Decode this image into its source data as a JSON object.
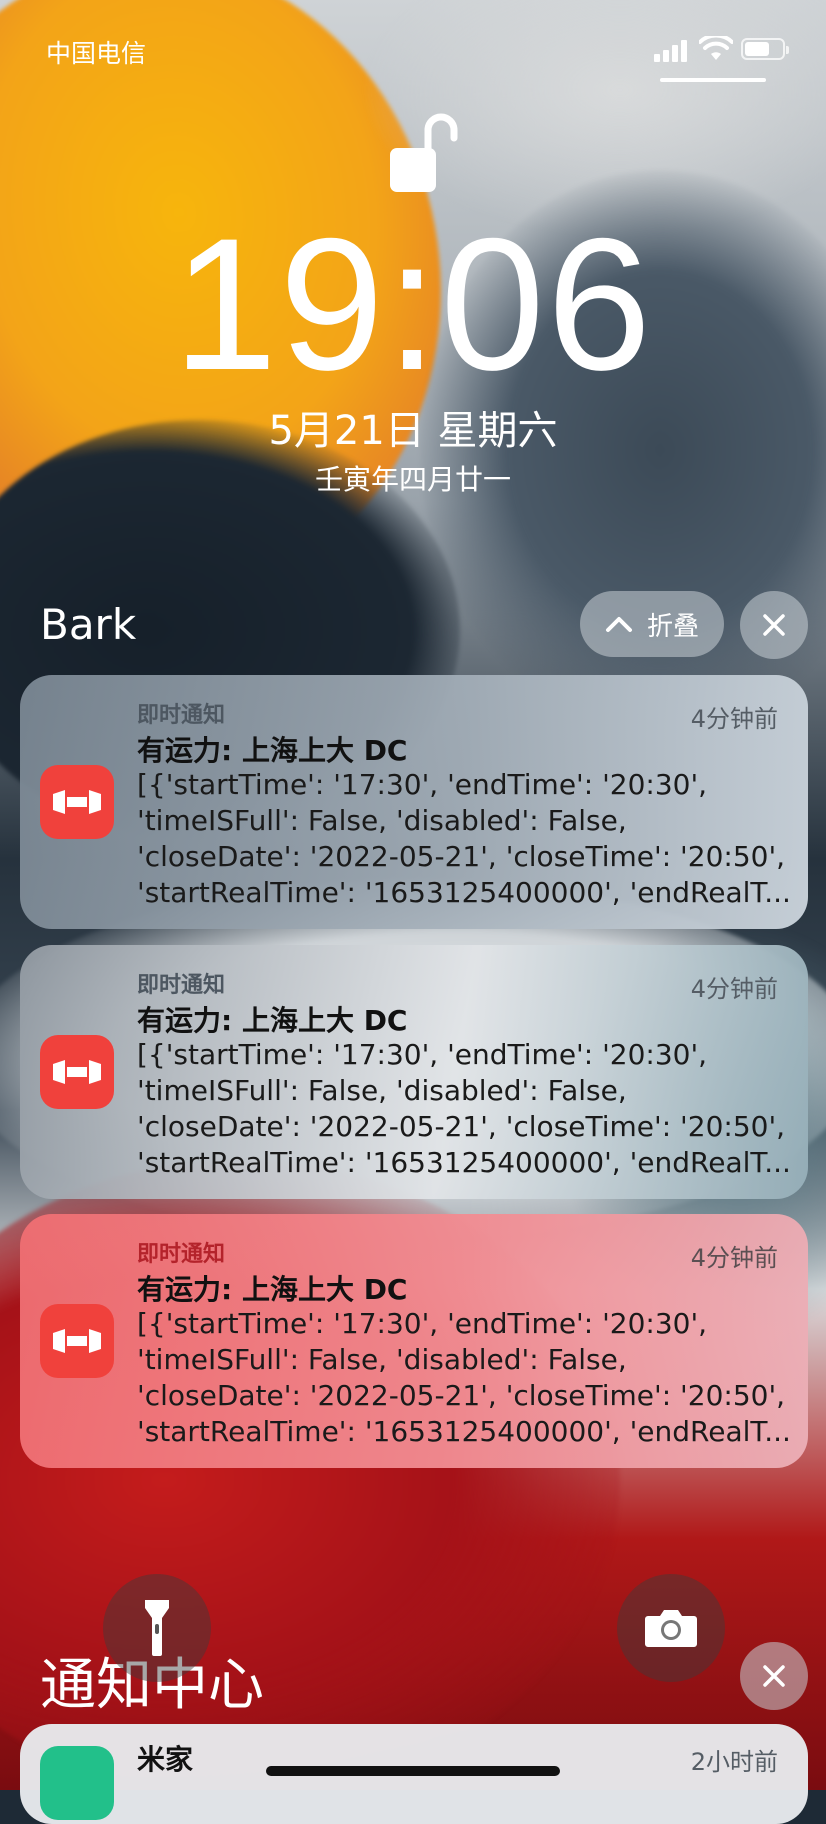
{
  "status_bar": {
    "carrier": "中国电信"
  },
  "lock_screen": {
    "time": "19:06",
    "date": "5月21日 星期六",
    "lunar_date": "壬寅年四月廿一"
  },
  "notification_group": {
    "app_name": "Bark",
    "collapse_label": "折叠",
    "notifications": [
      {
        "category": "即时通知",
        "time": "4分钟前",
        "title": "有运力: 上海上大 DC",
        "body": "[{'startTime': '17:30', 'endTime': '20:30',\n'timeISFull': False, 'disabled': False,\n'closeDate': '2022-05-21', 'closeTime': '20:50',\n'startRealTime': '1653125400000', 'endRealT..."
      },
      {
        "category": "即时通知",
        "time": "4分钟前",
        "title": "有运力: 上海上大 DC",
        "body": "[{'startTime': '17:30', 'endTime': '20:30',\n'timeISFull': False, 'disabled': False,\n'closeDate': '2022-05-21', 'closeTime': '20:50',\n'startRealTime': '1653125400000', 'endRealT..."
      },
      {
        "category": "即时通知",
        "time": "4分钟前",
        "title": "有运力: 上海上大 DC",
        "body": "[{'startTime': '17:30', 'endTime': '20:30',\n'timeISFull': False, 'disabled': False,\n'closeDate': '2022-05-21', 'closeTime': '20:50',\n'startRealTime': '1653125400000', 'endRealT..."
      }
    ]
  },
  "notification_center": {
    "title": "通知中心",
    "peek_notification": {
      "app_name": "米家",
      "time": "2小时前"
    }
  },
  "icons": {
    "lock": "lock-open-icon",
    "bark": "bark-app-icon",
    "flashlight": "flashlight-icon",
    "camera": "camera-icon",
    "close": "close-icon",
    "chevron": "chevron-up-icon"
  },
  "colors": {
    "bark_red": "#f0413c",
    "mijia_green": "#22c08a"
  }
}
